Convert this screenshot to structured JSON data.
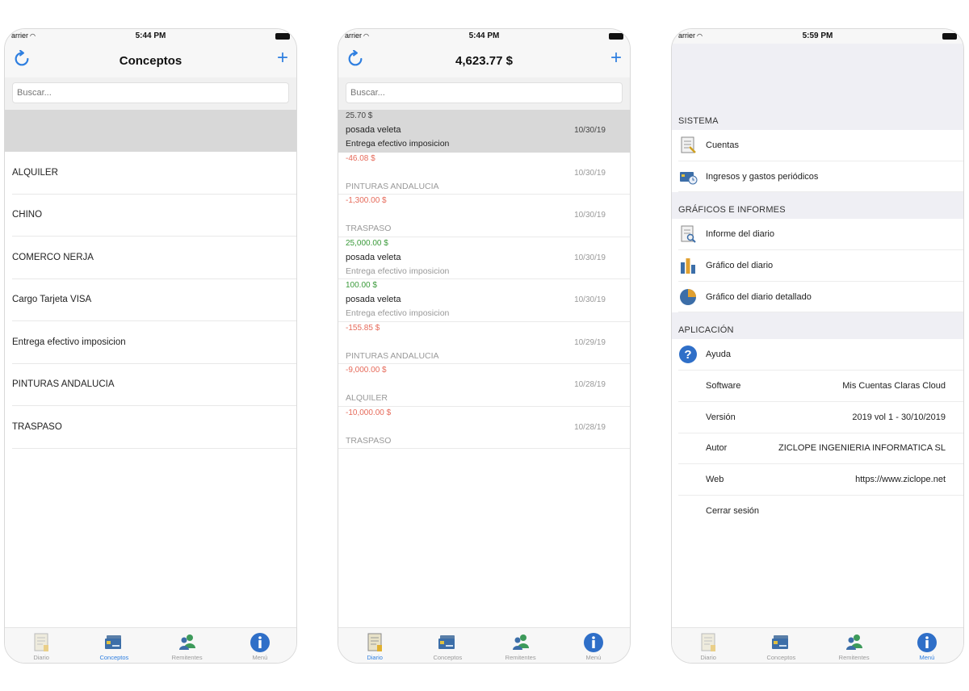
{
  "status": {
    "carrier": "arrier",
    "time_1": "5:44 PM",
    "time_2": "5:44 PM",
    "time_3": "5:59 PM"
  },
  "screen1": {
    "title": "Conceptos",
    "search_placeholder": "Buscar...",
    "items": [
      "ALQUILER",
      "CHINO",
      "COMERCO NERJA",
      "Cargo Tarjeta VISA",
      "Entrega efectivo imposicion",
      "PINTURAS ANDALUCIA",
      "TRASPASO"
    ]
  },
  "screen2": {
    "title": "4,623.77 $",
    "search_placeholder": "Buscar...",
    "transactions": [
      {
        "amount": "25.70 $",
        "payee": "posada veleta",
        "concept": "Entrega efectivo imposicion",
        "date": "10/30/19",
        "sign": "neutral"
      },
      {
        "amount": "-46.08 $",
        "payee": "",
        "concept": "PINTURAS ANDALUCIA",
        "date": "10/30/19",
        "sign": "neg"
      },
      {
        "amount": "-1,300.00 $",
        "payee": "",
        "concept": "TRASPASO",
        "date": "10/30/19",
        "sign": "neg"
      },
      {
        "amount": "25,000.00 $",
        "payee": "posada veleta",
        "concept": "Entrega efectivo imposicion",
        "date": "10/30/19",
        "sign": "pos"
      },
      {
        "amount": "100.00 $",
        "payee": "posada veleta",
        "concept": "Entrega efectivo imposicion",
        "date": "10/30/19",
        "sign": "pos"
      },
      {
        "amount": "-155.85 $",
        "payee": "",
        "concept": "PINTURAS ANDALUCIA",
        "date": "10/29/19",
        "sign": "neg"
      },
      {
        "amount": "-9,000.00 $",
        "payee": "",
        "concept": "ALQUILER",
        "date": "10/28/19",
        "sign": "neg"
      },
      {
        "amount": "-10,000.00 $",
        "payee": "",
        "concept": "TRASPASO",
        "date": "10/28/19",
        "sign": "neg"
      }
    ]
  },
  "screen3": {
    "sections": {
      "sistema": "SISTEMA",
      "graficos": "GRÁFICOS E INFORMES",
      "aplicacion": "APLICACIÓN"
    },
    "sistema_items": {
      "cuentas": "Cuentas",
      "ingresos": "Ingresos y gastos periódicos"
    },
    "graficos_items": {
      "informe": "Informe del diario",
      "grafico": "Gráfico del diario",
      "detallado": "Gráfico del diario detallado"
    },
    "app_items": {
      "ayuda": "Ayuda",
      "software_label": "Software",
      "software_value": "Mis Cuentas Claras Cloud",
      "version_label": "Versión",
      "version_value": "2019 vol 1 - 30/10/2019",
      "autor_label": "Autor",
      "autor_value": "ZICLOPE INGENIERIA INFORMATICA SL",
      "web_label": "Web",
      "web_value": "https://www.ziclope.net",
      "cerrar": "Cerrar sesión"
    }
  },
  "tabs": {
    "diario": "Diario",
    "conceptos": "Conceptos",
    "remitentes": "Remitentes",
    "menu": "Menú"
  },
  "colors": {
    "accent": "#2f7fe0",
    "positive": "#3a9a3a",
    "negative": "#e66a5a",
    "selected_row": "#d8d8d8"
  }
}
